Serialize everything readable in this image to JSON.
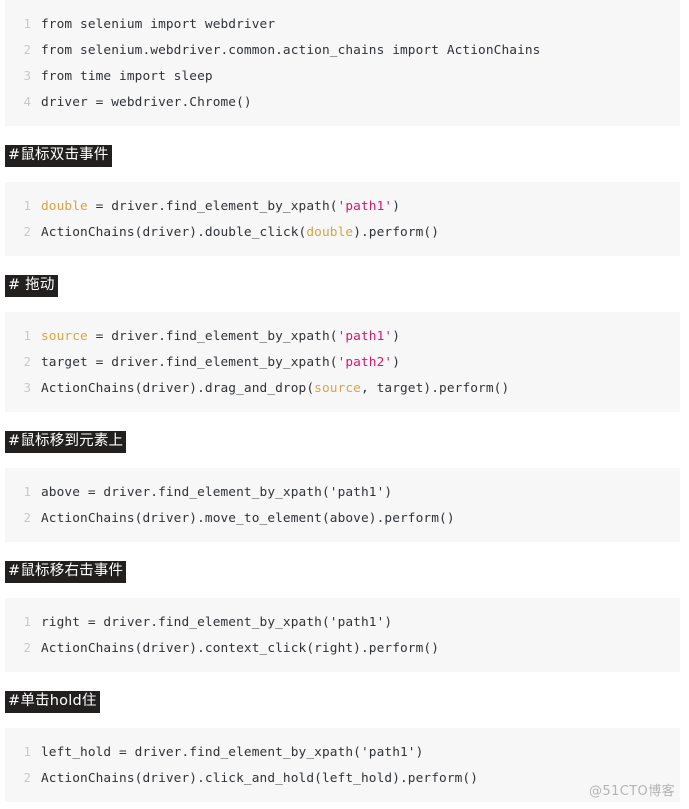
{
  "document": {
    "language": "python",
    "theme": {
      "page_background": "#ffffff",
      "code_background": "#f7f7f8",
      "code_text": "#2f3337",
      "line_number": "#c9c9cc",
      "variable_token": "#d9a441",
      "string_token": "#e3116c",
      "heading_highlight_background": "#221f1f",
      "heading_highlight_text": "#ffffff",
      "watermark": "#b4b4b4"
    }
  },
  "watermark": {
    "text": "@51CTO博客"
  },
  "sections": [
    {
      "id": "imports",
      "heading": null,
      "code": {
        "lines": [
          {
            "number": "1",
            "tokens": [
              {
                "text": "from selenium import webdriver",
                "type": "plain"
              }
            ]
          },
          {
            "number": "2",
            "tokens": [
              {
                "text": "from selenium.webdriver.common.action_chains import ActionChains",
                "type": "plain"
              }
            ]
          },
          {
            "number": "3",
            "tokens": [
              {
                "text": "from time import sleep",
                "type": "plain"
              }
            ]
          },
          {
            "number": "4",
            "tokens": [
              {
                "text": "driver = webdriver.Chrome()",
                "type": "plain"
              }
            ]
          }
        ]
      }
    },
    {
      "id": "double-click",
      "heading": "#鼠标双击事件",
      "code": {
        "lines": [
          {
            "number": "1",
            "tokens": [
              {
                "text": "double",
                "type": "variable"
              },
              {
                "text": " = driver.find_element_by_xpath(",
                "type": "plain"
              },
              {
                "text": "'path1'",
                "type": "string"
              },
              {
                "text": ")",
                "type": "plain"
              }
            ]
          },
          {
            "number": "2",
            "tokens": [
              {
                "text": "ActionChains(driver).double_click(",
                "type": "plain"
              },
              {
                "text": "double",
                "type": "variable"
              },
              {
                "text": ").perform()",
                "type": "plain"
              }
            ]
          }
        ]
      }
    },
    {
      "id": "drag",
      "heading": "# 拖动",
      "code": {
        "lines": [
          {
            "number": "1",
            "tokens": [
              {
                "text": "source",
                "type": "variable"
              },
              {
                "text": " = driver.find_element_by_xpath(",
                "type": "plain"
              },
              {
                "text": "'path1'",
                "type": "string"
              },
              {
                "text": ")",
                "type": "plain"
              }
            ]
          },
          {
            "number": "2",
            "tokens": [
              {
                "text": "target = driver.find_element_by_xpath(",
                "type": "plain"
              },
              {
                "text": "'path2'",
                "type": "string"
              },
              {
                "text": ")",
                "type": "plain"
              }
            ]
          },
          {
            "number": "3",
            "tokens": [
              {
                "text": "ActionChains(driver).drag_and_drop(",
                "type": "plain"
              },
              {
                "text": "source",
                "type": "variable"
              },
              {
                "text": ", target).perform()",
                "type": "plain"
              }
            ]
          }
        ]
      }
    },
    {
      "id": "move-to-element",
      "heading": "#鼠标移到元素上",
      "code": {
        "lines": [
          {
            "number": "1",
            "tokens": [
              {
                "text": "above = driver.find_element_by_xpath('path1')",
                "type": "plain"
              }
            ]
          },
          {
            "number": "2",
            "tokens": [
              {
                "text": "ActionChains(driver).move_to_element(above).perform()",
                "type": "plain"
              }
            ]
          }
        ]
      }
    },
    {
      "id": "right-click",
      "heading": "#鼠标移右击事件",
      "code": {
        "lines": [
          {
            "number": "1",
            "tokens": [
              {
                "text": "right = driver.find_element_by_xpath('path1')",
                "type": "plain"
              }
            ]
          },
          {
            "number": "2",
            "tokens": [
              {
                "text": "ActionChains(driver).context_click(right).perform()",
                "type": "plain"
              }
            ]
          }
        ]
      }
    },
    {
      "id": "click-and-hold",
      "heading": "#单击hold住",
      "code": {
        "lines": [
          {
            "number": "1",
            "tokens": [
              {
                "text": "left_hold = driver.find_element_by_xpath('path1')",
                "type": "plain"
              }
            ]
          },
          {
            "number": "2",
            "tokens": [
              {
                "text": "ActionChains(driver).click_and_hold(left_hold).perform()",
                "type": "plain"
              }
            ]
          }
        ]
      }
    }
  ]
}
